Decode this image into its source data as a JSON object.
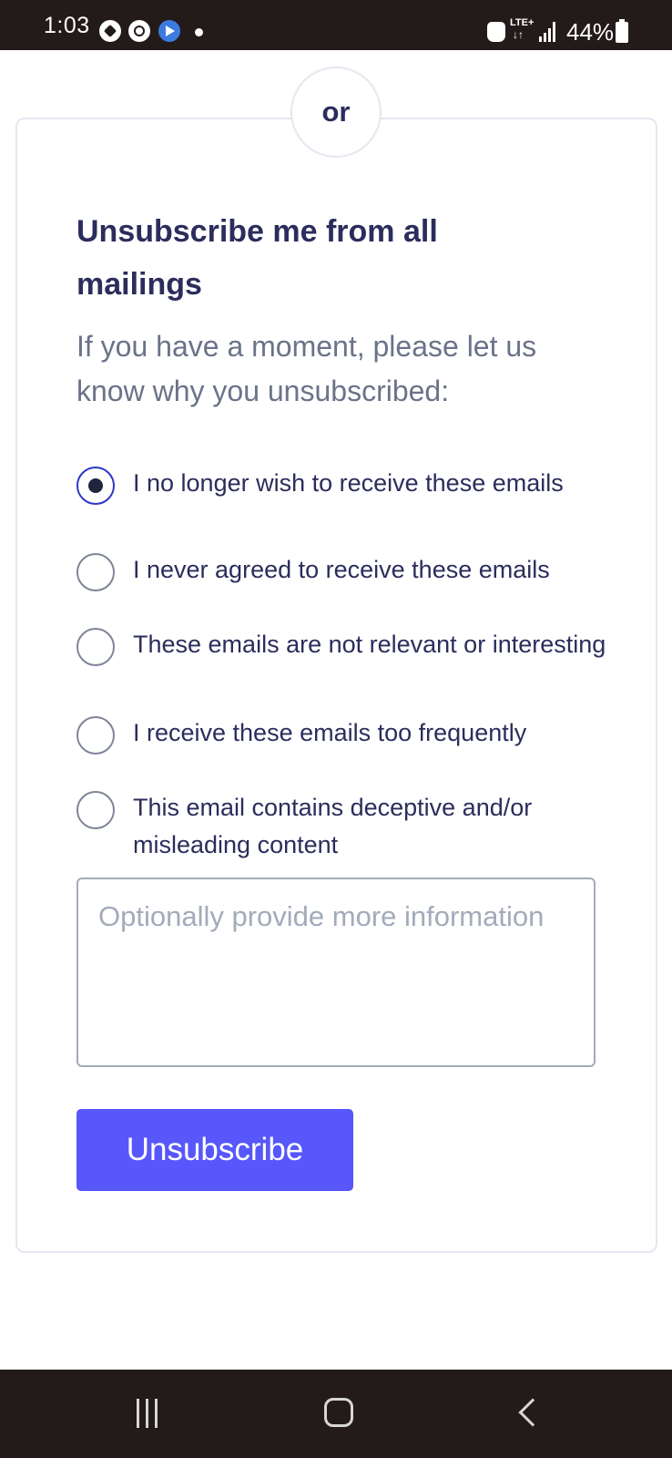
{
  "status_bar": {
    "time": "1:03",
    "network": "LTE+",
    "network_arrows": "↓↑",
    "battery": "44%",
    "notification_icons": [
      "soccer-ball-icon",
      "chrome-icon",
      "bing-icon",
      "dot-icon"
    ],
    "system_icons": [
      "vpn-icon",
      "signal-icon",
      "battery-icon"
    ]
  },
  "divider": {
    "label": "or"
  },
  "form": {
    "heading": "Unsubscribe me from all mailings",
    "subtext": "If you have a moment, please let us know why you unsubscribed:",
    "options": [
      {
        "label": "I no longer wish to receive these emails",
        "checked": true
      },
      {
        "label": "I never agreed to receive these emails",
        "checked": false
      },
      {
        "label": "These emails are not relevant or interesting",
        "checked": false
      },
      {
        "label": "I receive these emails too frequently",
        "checked": false
      },
      {
        "label": "This email contains deceptive and/or misleading content",
        "checked": false
      }
    ],
    "feedback": {
      "placeholder": "Optionally provide more information",
      "value": ""
    },
    "submit_label": "Unsubscribe"
  },
  "nav_bar": {
    "icons": [
      "recents-icon",
      "home-icon",
      "back-icon"
    ]
  },
  "colors": {
    "primary": "#5757fb",
    "heading": "#2b2d5c",
    "muted": "#6b7389",
    "radio_selected": "#2e36c8",
    "system_bar": "#231a1a"
  }
}
